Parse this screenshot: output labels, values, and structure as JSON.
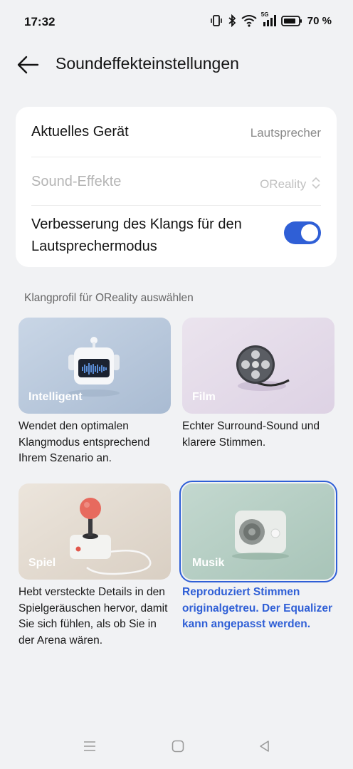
{
  "status_bar": {
    "time": "17:32",
    "network": "5G",
    "battery_percent": "70 %",
    "icons": [
      "vibrate-icon",
      "bluetooth-icon",
      "wifi-icon",
      "signal-icon",
      "battery-icon"
    ]
  },
  "header": {
    "back_icon": "arrow-left-icon",
    "title": "Soundeffekteinstellungen"
  },
  "settings": {
    "current_device_label": "Aktuelles Gerät",
    "current_device_value": "Lautsprecher",
    "sound_effects_label": "Sound-Effekte",
    "sound_effects_value": "OReality",
    "enhancement_label": "Verbesserung des Klangs für den Lautsprechermodus",
    "enhancement_enabled": true
  },
  "profile_section": {
    "header": "Klangprofil für OReality auswählen",
    "profiles": [
      {
        "name": "Intelligent",
        "description": "Wendet den optimalen Klangmodus entsprechend Ihrem Szenario an.",
        "selected": false
      },
      {
        "name": "Film",
        "description": "Echter Surround-Sound und klarere Stimmen.",
        "selected": false
      },
      {
        "name": "Spiel",
        "description": "Hebt versteckte Details in den Spielgeräuschen hervor, damit Sie sich fühlen, als ob Sie in der Arena wären.",
        "selected": false
      },
      {
        "name": "Musik",
        "description": "Reproduziert Stimmen originalgetreu. Der Equalizer kann angepasst werden.",
        "selected": true
      }
    ]
  },
  "colors": {
    "accent": "#2f5fd6",
    "background": "#f1f2f4",
    "card": "#ffffff"
  },
  "nav_bar": {
    "icons": [
      "menu-icon",
      "home-icon",
      "back-triangle-icon"
    ]
  }
}
